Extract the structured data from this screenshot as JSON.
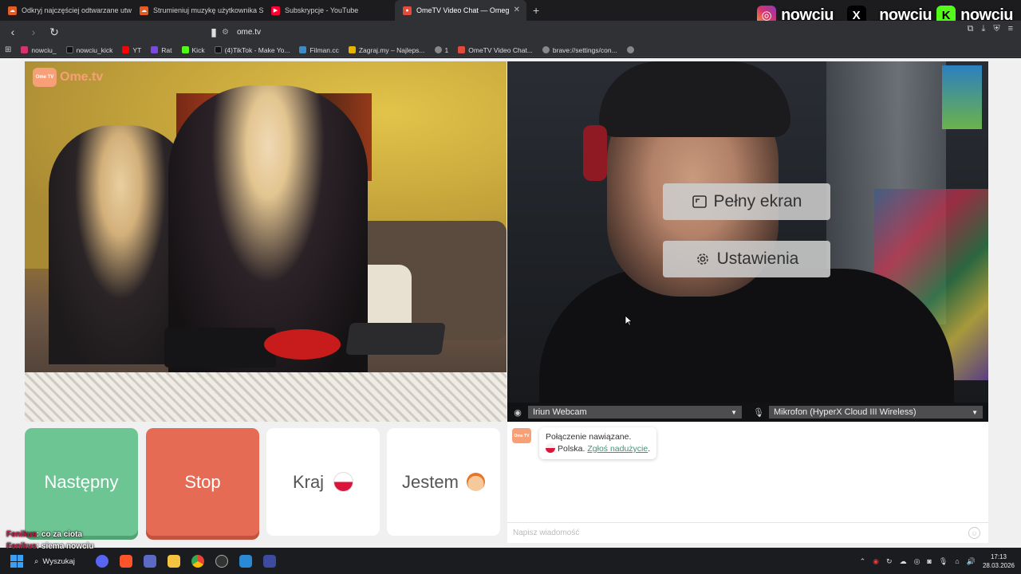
{
  "browser": {
    "tabs": [
      {
        "title": "Odkryj najczęściej odtwarzane utwo",
        "color": "#e45b24",
        "active": false
      },
      {
        "title": "Strumieniuj muzykę użytkownika SF",
        "color": "#e45b24",
        "active": false
      },
      {
        "title": "Subskrypcje - YouTube",
        "color": "#ff0033",
        "active": false
      },
      {
        "title": "OmeTV Video Chat — Omeg",
        "color": "#e24b3c",
        "active": true
      }
    ],
    "new_tab": "+",
    "url": "ome.tv",
    "bookmarks": [
      {
        "label": "nowciu_",
        "color": "#d6336c"
      },
      {
        "label": "nowciu_kick",
        "color": "#111111"
      },
      {
        "label": "YT",
        "color": "#ff0000"
      },
      {
        "label": "Rat",
        "color": "#7a4ae0"
      },
      {
        "label": "Kick",
        "color": "#53fc18"
      },
      {
        "label": "(4)TikTok - Make Yo...",
        "color": "#111111"
      },
      {
        "label": "Filman.cc",
        "color": "#3d8ac4"
      },
      {
        "label": "Zagraj.my – Najleps...",
        "color": "#e8b200"
      },
      {
        "label": "1",
        "color": "#888888"
      },
      {
        "label": "OmeTV Video Chat...",
        "color": "#e24b3c"
      },
      {
        "label": "brave://settings/con...",
        "color": "#888888"
      }
    ]
  },
  "stream_overlay": {
    "items": [
      {
        "icon": "instagram-icon",
        "text": "nowciu_",
        "color": "#d6336c"
      },
      {
        "icon": "x-icon",
        "text": "_nowciu",
        "color": "#000000"
      },
      {
        "icon": "kick-icon",
        "text": "nowciu",
        "color": "#53fc18"
      }
    ],
    "chat": [
      {
        "user": "Fenikus",
        "text": ": co za ciota"
      },
      {
        "user": "Fenikus",
        "text": ": siema nowciu"
      }
    ]
  },
  "ometv": {
    "logo": "Ome.tv",
    "logo_badge": "Ome TV",
    "camera_menu": {
      "fullscreen": "Pełny ekran",
      "settings": "Ustawienia"
    },
    "devices": {
      "webcam": "Iriun Webcam",
      "microphone": "Mikrofon (HyperX Cloud III Wireless)"
    },
    "buttons": {
      "next": "Następny",
      "stop": "Stop",
      "country": "Kraj",
      "me": "Jestem"
    },
    "chat": {
      "line1": "Połączenie nawiązane.",
      "country": "Polska.",
      "report_link": "Zgłoś nadużycie",
      "period": ".",
      "input_placeholder": "Napisz wiadomość"
    }
  },
  "taskbar": {
    "search": "Wyszukaj",
    "time": "17:13",
    "date": "28.03.2026"
  }
}
